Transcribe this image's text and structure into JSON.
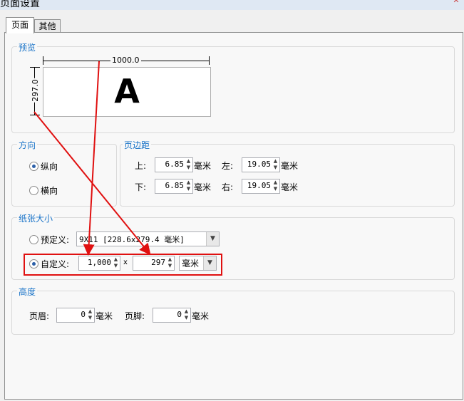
{
  "window": {
    "title": "页面设置",
    "close_glyph": "✕"
  },
  "tabs": [
    {
      "label": "页面",
      "active": true
    },
    {
      "label": "其他",
      "active": false
    }
  ],
  "preview": {
    "title": "预览",
    "width_label": "1000.0",
    "height_label": "297.0",
    "letter": "A"
  },
  "orientation": {
    "title": "方向",
    "options": [
      {
        "label": "纵向",
        "selected": true
      },
      {
        "label": "横向",
        "selected": false
      }
    ]
  },
  "margins": {
    "title": "页边距",
    "top": {
      "label": "上:",
      "value": "6.85"
    },
    "left": {
      "label": "左:",
      "value": "19.05"
    },
    "bottom": {
      "label": "下:",
      "value": "6.85"
    },
    "right": {
      "label": "右:",
      "value": "19.05"
    },
    "unit": "毫米"
  },
  "paper_size": {
    "title": "纸张大小",
    "predefined": {
      "label": "预定义:",
      "value": "9X11 [228.6x279.4 毫米]",
      "selected": false
    },
    "custom": {
      "label": "自定义:",
      "width": "1,000",
      "times": "x",
      "height": "297",
      "unit": "毫米",
      "selected": true
    }
  },
  "height_section": {
    "title": "高度",
    "header": {
      "label": "页眉:",
      "value": "0",
      "unit": "毫米"
    },
    "footer": {
      "label": "页脚:",
      "value": "0",
      "unit": "毫米"
    }
  },
  "colors": {
    "accent_title": "#1a74c8",
    "annotation_red": "#e01010"
  },
  "icons": {
    "spinner": "updown-spinner-icon",
    "dropdown": "chevron-down-icon"
  }
}
